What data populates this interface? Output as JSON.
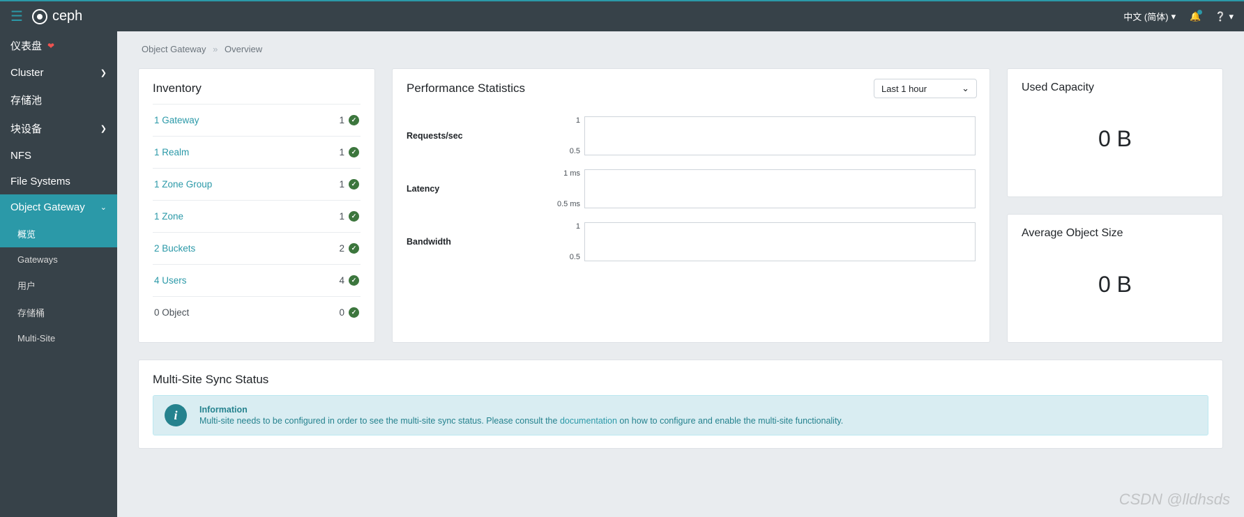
{
  "header": {
    "brand": "ceph",
    "language": "中文 (简体)"
  },
  "sidebar": {
    "items": [
      {
        "label": "仪表盘",
        "icon": "heart"
      },
      {
        "label": "Cluster",
        "chevron": true
      },
      {
        "label": "存储池"
      },
      {
        "label": "块设备",
        "chevron": true
      },
      {
        "label": "NFS"
      },
      {
        "label": "File Systems"
      },
      {
        "label": "Object Gateway",
        "active": true,
        "expanded": true
      }
    ],
    "subitems": [
      {
        "label": "概览",
        "active": true
      },
      {
        "label": "Gateways"
      },
      {
        "label": "用户"
      },
      {
        "label": "存储桶"
      },
      {
        "label": "Multi-Site"
      }
    ]
  },
  "breadcrumb": {
    "root": "Object Gateway",
    "page": "Overview"
  },
  "inventory": {
    "title": "Inventory",
    "rows": [
      {
        "label": "1 Gateway",
        "count": "1",
        "link": true
      },
      {
        "label": "1 Realm",
        "count": "1",
        "link": true
      },
      {
        "label": "1 Zone Group",
        "count": "1",
        "link": true
      },
      {
        "label": "1 Zone",
        "count": "1",
        "link": true
      },
      {
        "label": "2 Buckets",
        "count": "2",
        "link": true
      },
      {
        "label": "4 Users",
        "count": "4",
        "link": true
      },
      {
        "label": "0 Object",
        "count": "0",
        "link": false
      }
    ]
  },
  "performance": {
    "title": "Performance Statistics",
    "time_range": "Last 1 hour",
    "metrics": [
      {
        "label": "Requests/sec",
        "tick_hi": "1",
        "tick_lo": "0.5"
      },
      {
        "label": "Latency",
        "tick_hi": "1 ms",
        "tick_lo": "0.5 ms"
      },
      {
        "label": "Bandwidth",
        "tick_hi": "1",
        "tick_lo": "0.5"
      }
    ]
  },
  "stats": {
    "used_capacity": {
      "title": "Used Capacity",
      "value": "0 B"
    },
    "avg_object_size": {
      "title": "Average Object Size",
      "value": "0 B"
    }
  },
  "sync": {
    "title": "Multi-Site Sync Status",
    "info_title": "Information",
    "info_text_before": "Multi-site needs to be configured in order to see the multi-site sync status. Please consult the ",
    "info_link": "documentation",
    "info_text_after": " on how to configure and enable the multi-site functionality."
  },
  "watermark": "CSDN @lldhsds",
  "chart_data": [
    {
      "type": "line",
      "title": "Requests/sec",
      "ylim": [
        0,
        1
      ],
      "yticks": [
        0.5,
        1
      ],
      "series": [
        {
          "name": "Requests/sec",
          "values": []
        }
      ]
    },
    {
      "type": "line",
      "title": "Latency",
      "ylim": [
        0,
        1
      ],
      "yticks": [
        0.5,
        1
      ],
      "unit": "ms",
      "series": [
        {
          "name": "Latency",
          "values": []
        }
      ]
    },
    {
      "type": "line",
      "title": "Bandwidth",
      "ylim": [
        0,
        1
      ],
      "yticks": [
        0.5,
        1
      ],
      "series": [
        {
          "name": "Bandwidth",
          "values": []
        }
      ]
    }
  ]
}
